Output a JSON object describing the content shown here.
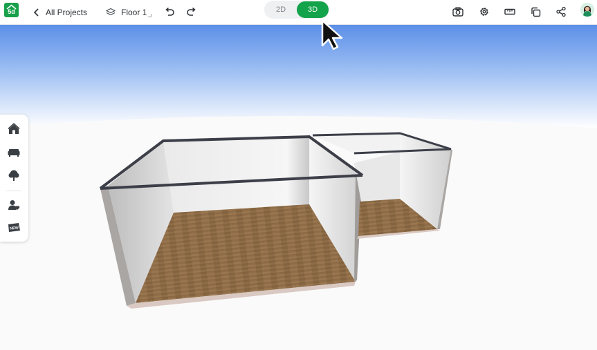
{
  "app": {
    "logo_text": "5d",
    "brand_color": "#19a04b"
  },
  "topbar": {
    "back_icon": "chevron-left-icon",
    "back_label": "All Projects",
    "floor_icon": "layers-icon",
    "floor_label": "Floor 1",
    "undo_icon": "undo-icon",
    "redo_icon": "redo-icon",
    "view_toggle": {
      "options": [
        "2D",
        "3D"
      ],
      "selected": "3D",
      "active_color": "#13a34a"
    },
    "right_icons": [
      "camera-icon",
      "gear-icon",
      "ruler-icon",
      "copy-icon",
      "share-icon",
      "user-avatar"
    ]
  },
  "sidebar": {
    "items": [
      "home-icon",
      "sofa-icon",
      "tree-icon",
      "people-icon",
      "new-badge-icon"
    ],
    "new_badge_text": "NEW"
  },
  "scene": {
    "description_type": "3d-floorplan",
    "floor_color": "#8a6a46",
    "sky_top": "#5a8ee6"
  }
}
